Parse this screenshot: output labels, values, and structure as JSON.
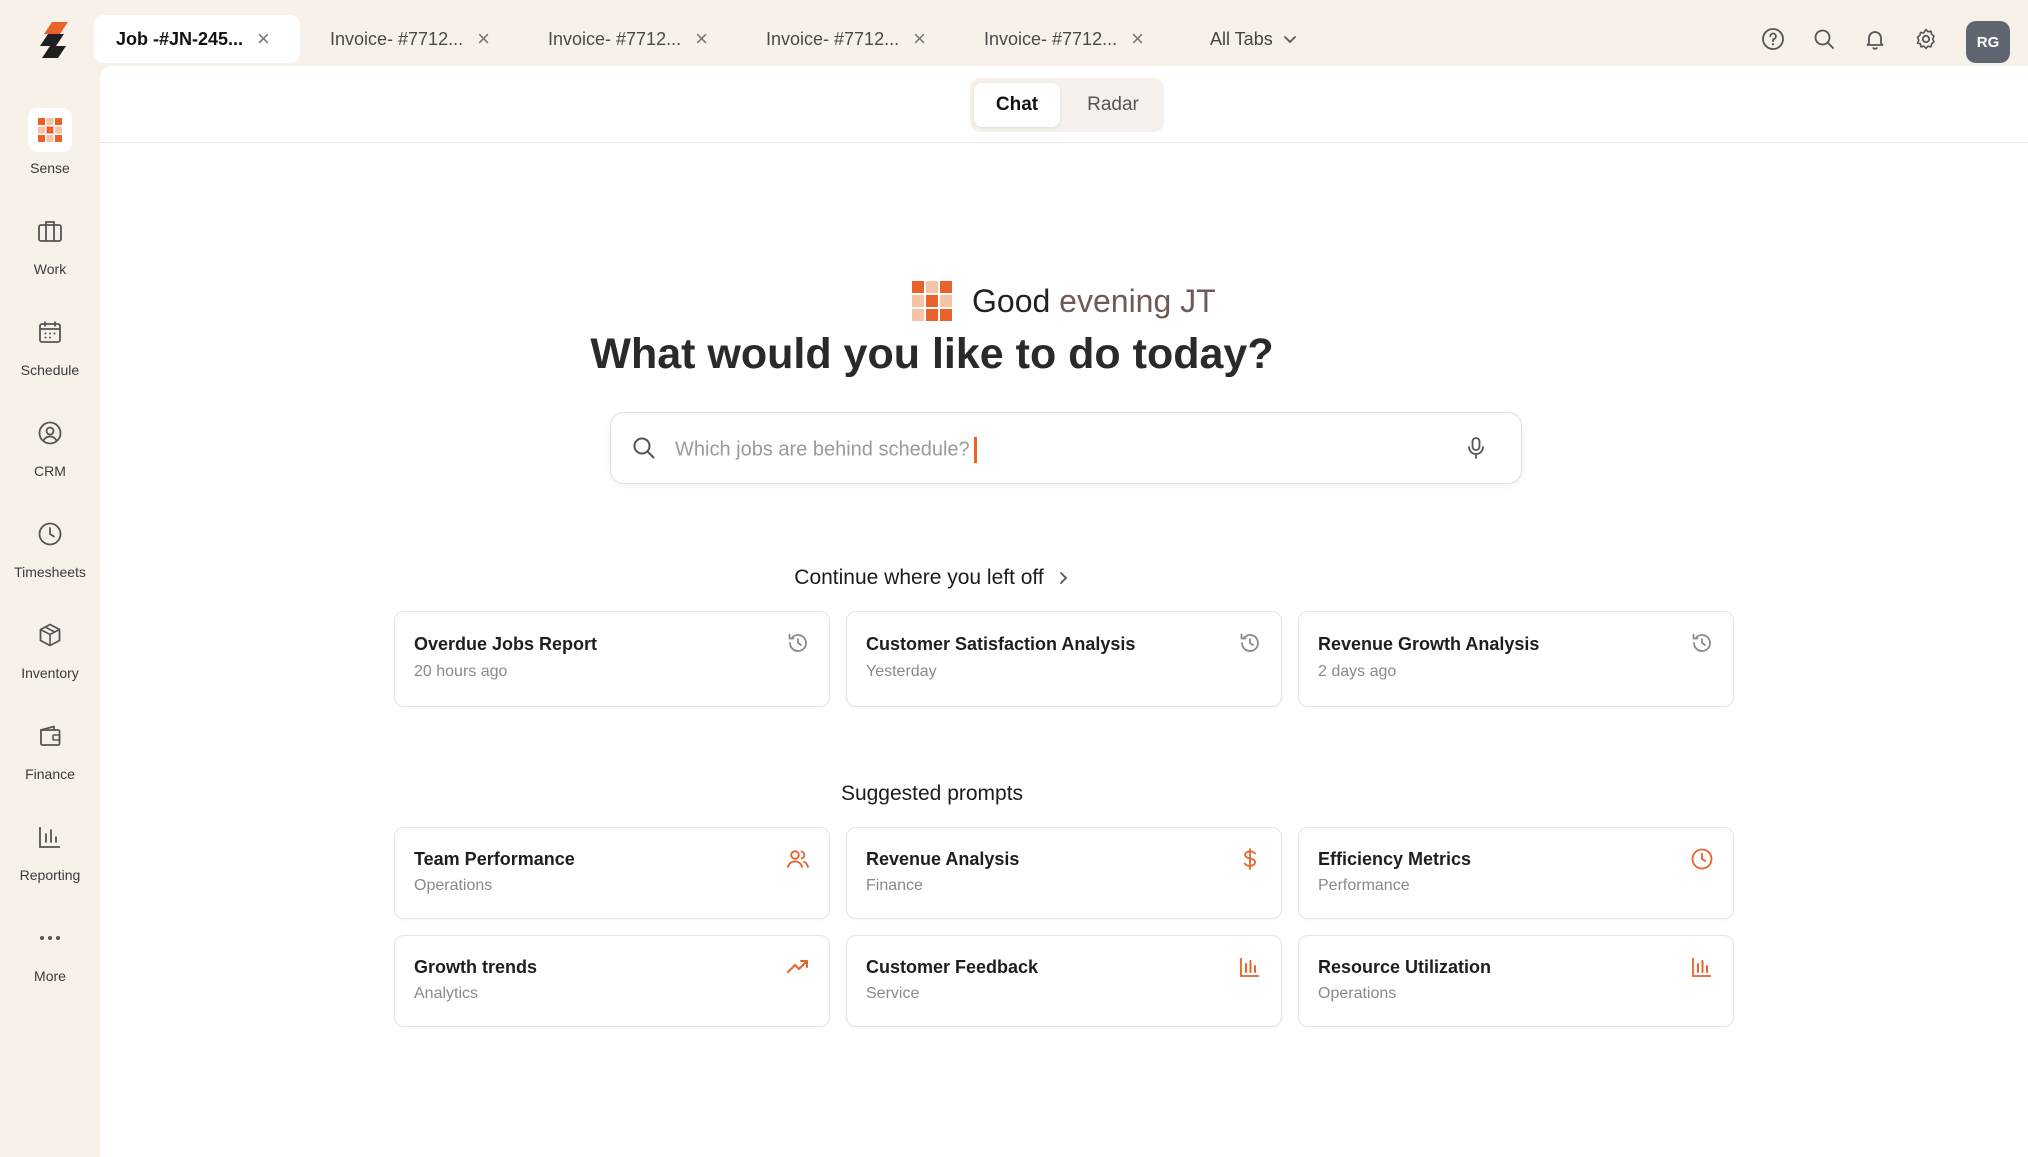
{
  "tabs": [
    {
      "label": "Job -#JN-245...",
      "active": true
    },
    {
      "label": "Invoice- #7712...",
      "active": false
    },
    {
      "label": "Invoice- #7712...",
      "active": false
    },
    {
      "label": "Invoice- #7712...",
      "active": false
    },
    {
      "label": "Invoice- #7712...",
      "active": false
    }
  ],
  "tab_close_glyph": "×",
  "all_tabs_label": "All Tabs",
  "toolbar_icons": [
    "help-icon",
    "search-icon",
    "bell-icon",
    "gear-icon"
  ],
  "avatar_initials": "RG",
  "sidebar": {
    "items": [
      {
        "label": "Sense",
        "icon": "sense-grid-icon",
        "active": true
      },
      {
        "label": "Work",
        "icon": "briefcase-icon",
        "active": false
      },
      {
        "label": "Schedule",
        "icon": "calendar-icon",
        "active": false
      },
      {
        "label": "CRM",
        "icon": "user-circle-icon",
        "active": false
      },
      {
        "label": "Timesheets",
        "icon": "clock-icon",
        "active": false
      },
      {
        "label": "Inventory",
        "icon": "box-icon",
        "active": false
      },
      {
        "label": "Finance",
        "icon": "wallet-icon",
        "active": false
      },
      {
        "label": "Reporting",
        "icon": "bar-chart-icon",
        "active": false
      },
      {
        "label": "More",
        "icon": "more-icon",
        "active": false
      }
    ]
  },
  "segmented": {
    "chat": "Chat",
    "radar": "Radar",
    "selected": "Chat"
  },
  "greeting": {
    "prefix": "Good ",
    "accent": "evening JT"
  },
  "headline": "What would you like to do today?",
  "search": {
    "placeholder": "Which jobs are behind schedule?"
  },
  "recent": {
    "title": "Continue where you left off",
    "items": [
      {
        "title": "Overdue Jobs Report",
        "time": "20 hours ago",
        "icon": "history-icon"
      },
      {
        "title": "Customer Satisfaction Analysis",
        "time": "Yesterday",
        "icon": "history-icon"
      },
      {
        "title": "Revenue Growth Analysis",
        "time": "2 days ago",
        "icon": "history-icon"
      }
    ]
  },
  "suggested": {
    "title": "Suggested prompts",
    "items": [
      {
        "title": "Team Performance",
        "category": "Operations",
        "icon": "users-icon"
      },
      {
        "title": "Revenue Analysis",
        "category": "Finance",
        "icon": "dollar-icon"
      },
      {
        "title": "Efficiency Metrics",
        "category": "Performance",
        "icon": "clock-icon"
      },
      {
        "title": "Growth trends",
        "category": "Analytics",
        "icon": "trending-up-icon"
      },
      {
        "title": "Customer Feedback",
        "category": "Service",
        "icon": "bar-chart-icon"
      },
      {
        "title": "Resource Utilization",
        "category": "Operations",
        "icon": "bar-chart-icon"
      }
    ]
  },
  "colors": {
    "accent": "#e8622a",
    "sidebar_bg": "#f7f1ea",
    "main_bg": "#ffffff",
    "avatar_bg": "#5f6672"
  }
}
